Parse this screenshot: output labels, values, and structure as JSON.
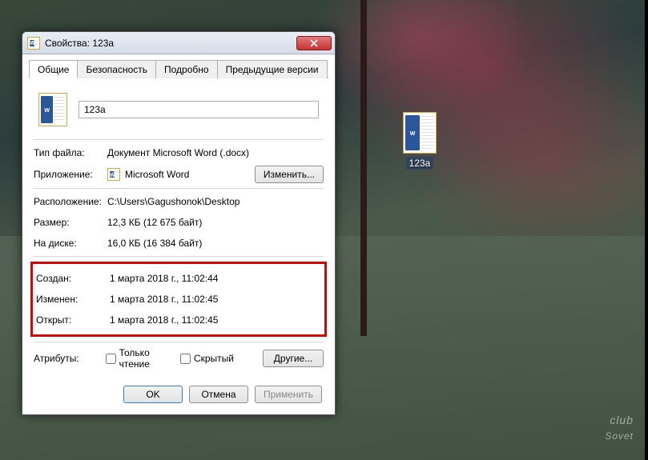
{
  "desktop": {
    "file_icon_label": "123a"
  },
  "watermark": {
    "small": "club",
    "main": "Sovet"
  },
  "dialog": {
    "title": "Свойства: 123a",
    "tabs": [
      "Общие",
      "Безопасность",
      "Подробно",
      "Предыдущие версии"
    ],
    "filename": "123a",
    "rows": {
      "file_type_label": "Тип файла:",
      "file_type_value": "Документ Microsoft Word (.docx)",
      "app_label": "Приложение:",
      "app_value": "Microsoft Word",
      "change_button": "Изменить...",
      "location_label": "Расположение:",
      "location_value": "C:\\Users\\Gagushonok\\Desktop",
      "size_label": "Размер:",
      "size_value": "12,3 КБ (12 675 байт)",
      "disk_label": "На диске:",
      "disk_value": "16,0 КБ (16 384 байт)",
      "created_label": "Создан:",
      "created_value": "1 марта 2018 г., 11:02:44",
      "modified_label": "Изменен:",
      "modified_value": "1 марта 2018 г., 11:02:45",
      "accessed_label": "Открыт:",
      "accessed_value": "1 марта 2018 г., 11:02:45",
      "attributes_label": "Атрибуты:",
      "readonly_label": "Только чтение",
      "hidden_label": "Скрытый",
      "other_button": "Другие..."
    },
    "buttons": {
      "ok": "OK",
      "cancel": "Отмена",
      "apply": "Применить"
    }
  }
}
